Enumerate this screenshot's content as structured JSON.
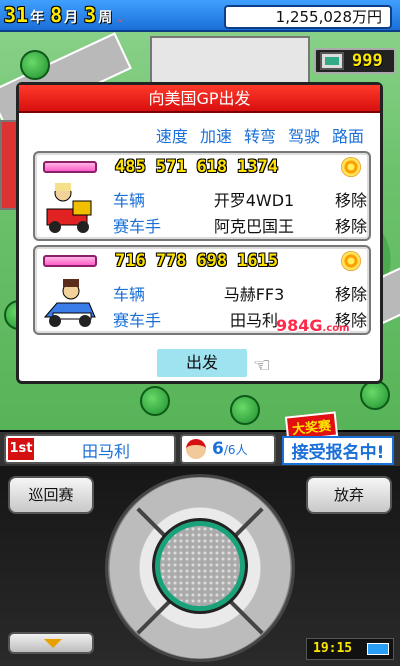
{
  "date": {
    "year": "31",
    "year_unit": "年",
    "month": "8",
    "month_unit": "月",
    "week": "3",
    "week_unit": "周",
    "dropdown": "⌄"
  },
  "money": "1,255,028万円",
  "points": "999",
  "dialog": {
    "title": "向美国GP出发",
    "stat_headers": [
      "速度",
      "加速",
      "转弯",
      "驾驶",
      "路面"
    ],
    "teams": [
      {
        "stats": [
          "485",
          "571",
          "618",
          "1374"
        ],
        "vehicle_label": "车辆",
        "vehicle": "开罗4WD1",
        "vehicle_remove": "移除",
        "driver_label": "赛车手",
        "driver": "阿克巴国王",
        "driver_remove": "移除"
      },
      {
        "stats": [
          "716",
          "778",
          "698",
          "1615"
        ],
        "vehicle_label": "车辆",
        "vehicle": "马赫FF3",
        "vehicle_remove": "移除",
        "driver_label": "赛车手",
        "driver": "田马利",
        "driver_remove": "移除"
      }
    ],
    "depart": "出发"
  },
  "watermark": {
    "brand": "984",
    "suffix": ".com"
  },
  "status": {
    "rank": "1st",
    "driver_name": "田马利",
    "crew_count": "6",
    "crew_total": "/6人",
    "event_tag": "大奖赛",
    "event_text": "接受报名中!"
  },
  "controls": {
    "left_button": "巡回赛",
    "right_button": "放弃",
    "clock": "19:15"
  },
  "colors": {
    "accent_blue": "#1a6fd8",
    "title_red": "#d80f0f",
    "number_yellow": "#ffe100"
  }
}
